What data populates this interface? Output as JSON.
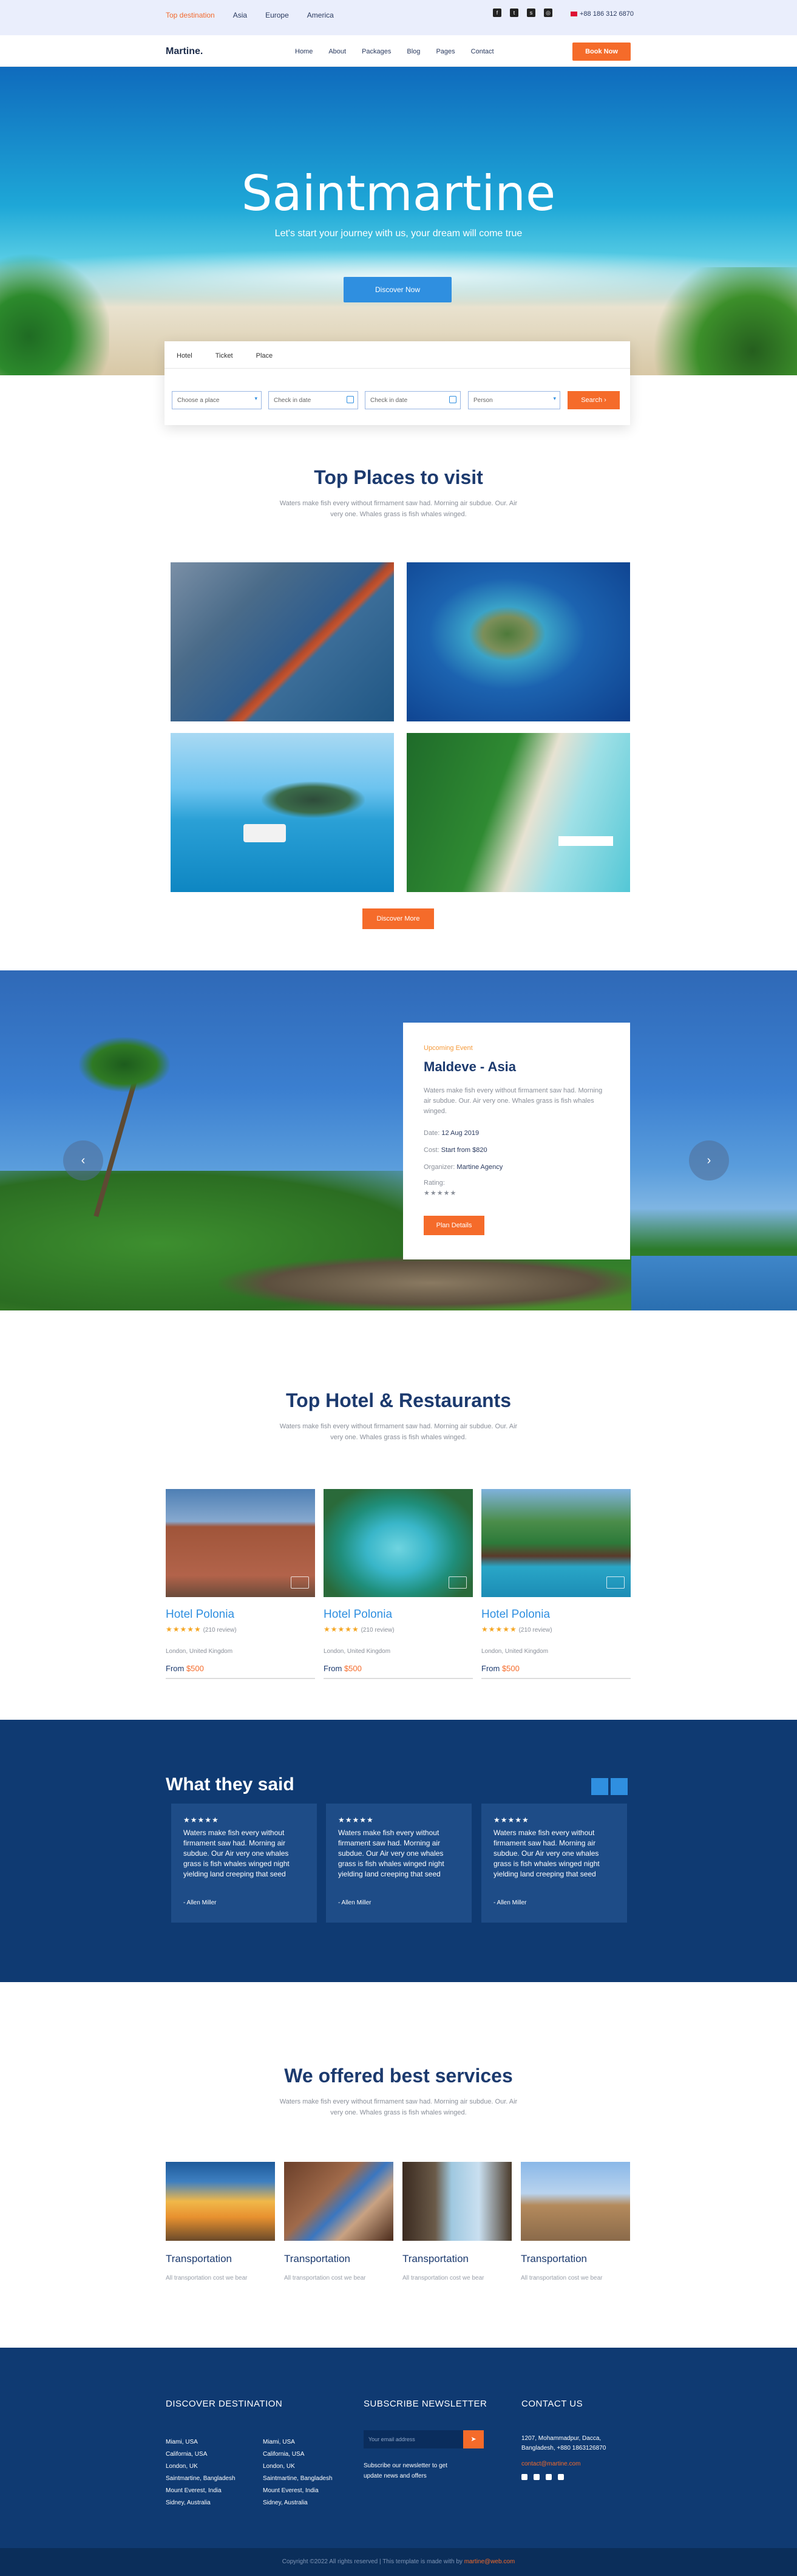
{
  "topbar": {
    "links": [
      "Top destination",
      "Asia",
      "Europe",
      "America"
    ],
    "phone": "+88 186 312 6870",
    "social": [
      "facebook-icon",
      "twitter-icon",
      "skype-icon",
      "instagram-icon"
    ]
  },
  "nav": {
    "logo": "Martine.",
    "menu": [
      "Home",
      "About",
      "Packages",
      "Blog",
      "Pages",
      "Contact"
    ],
    "book_label": "Book Now"
  },
  "hero": {
    "title": "Saintmartine",
    "subtitle": "Let's start your journey with us, your dream will come true",
    "button": "Discover Now"
  },
  "search": {
    "tabs": [
      "Hotel",
      "Ticket",
      "Place"
    ],
    "fields": [
      "Choose a place",
      "Check in date",
      "Check in date",
      "Person"
    ],
    "button": "Search ›"
  },
  "places": {
    "title": "Top Places to visit",
    "desc": "Waters make fish every without firmament saw had. Morning air subdue. Our. Air very one. Whales grass is fish whales winged.",
    "button": "Discover More"
  },
  "event": {
    "kicker": "Upcoming Event",
    "name": "Maldeve - Asia",
    "desc": "Waters make fish every without firmament saw had. Morning air subdue. Our. Air very one. Whales grass is fish whales winged.",
    "date_label": "Date:",
    "date": "12 Aug 2019",
    "cost_label": "Cost:",
    "cost": "Start from $820",
    "org_label": "Organizer:",
    "org": "Martine Agency",
    "rating_label": "Rating:",
    "stars": "★★★★★",
    "button": "Plan Details",
    "prev": "‹",
    "next": "›"
  },
  "hotels": {
    "title": "Top Hotel & Restaurants",
    "desc": "Waters make fish every without firmament saw had. Morning air subdue. Our. Air very one. Whales grass is fish whales winged.",
    "items": [
      {
        "name": "Hotel Polonia",
        "stars": "★★★★★",
        "reviews": "(210 review)",
        "location": "London, United Kingdom",
        "price_prefix": "From ",
        "price": "$500"
      },
      {
        "name": "Hotel Polonia",
        "stars": "★★★★★",
        "reviews": "(210 review)",
        "location": "London, United Kingdom",
        "price_prefix": "From ",
        "price": "$500"
      },
      {
        "name": "Hotel Polonia",
        "stars": "★★★★★",
        "reviews": "(210 review)",
        "location": "London, United Kingdom",
        "price_prefix": "From ",
        "price": "$500"
      }
    ]
  },
  "testimonials": {
    "title": "What they said",
    "items": [
      {
        "stars": "★★★★★",
        "text": "Waters make fish every without firmament saw had. Morning air subdue. Our Air very one whales grass is fish whales winged night yielding land creeping that seed",
        "author": "- Allen Miller"
      },
      {
        "stars": "★★★★★",
        "text": "Waters make fish every without firmament saw had. Morning air subdue. Our Air very one whales grass is fish whales winged night yielding land creeping that seed",
        "author": "- Allen Miller"
      },
      {
        "stars": "★★★★★",
        "text": "Waters make fish every without firmament saw had. Morning air subdue. Our Air very one whales grass is fish whales winged night yielding land creeping that seed",
        "author": "- Allen Miller"
      }
    ]
  },
  "services": {
    "title": "We offered best services",
    "desc": "Waters make fish every without firmament saw had. Morning air subdue. Our. Air very one. Whales grass is fish whales winged.",
    "items": [
      {
        "name": "Transportation",
        "desc": "All transportation cost we bear"
      },
      {
        "name": "Transportation",
        "desc": "All transportation cost we bear"
      },
      {
        "name": "Transportation",
        "desc": "All transportation cost we bear"
      },
      {
        "name": "Transportation",
        "desc": "All transportation cost we bear"
      }
    ]
  },
  "footer": {
    "discover_title": "DISCOVER DESTINATION",
    "col1": [
      "Miami, USA",
      "California, USA",
      "London, UK",
      "Saintmartine, Bangladesh",
      "Mount Everest, India",
      "Sidney, Australia"
    ],
    "col2": [
      "Miami, USA",
      "California, USA",
      "London, UK",
      "Saintmartine, Bangladesh",
      "Mount Everest, India",
      "Sidney, Australia"
    ],
    "newsletter_title": "SUBSCRIBE NEWSLETTER",
    "email_placeholder": "Your email address",
    "newsletter_text": "Subscribe our newsletter to get update news and offers",
    "contact_title": "CONTACT US",
    "address": "1207, Mohammadpur, Dacca, Bangladesh, +880 1863126870",
    "email": "contact@martine.com"
  },
  "copyright": {
    "text": "Copyright ©2022 All rights reserved | This template is made with by ",
    "brand": "martine@web.com"
  }
}
